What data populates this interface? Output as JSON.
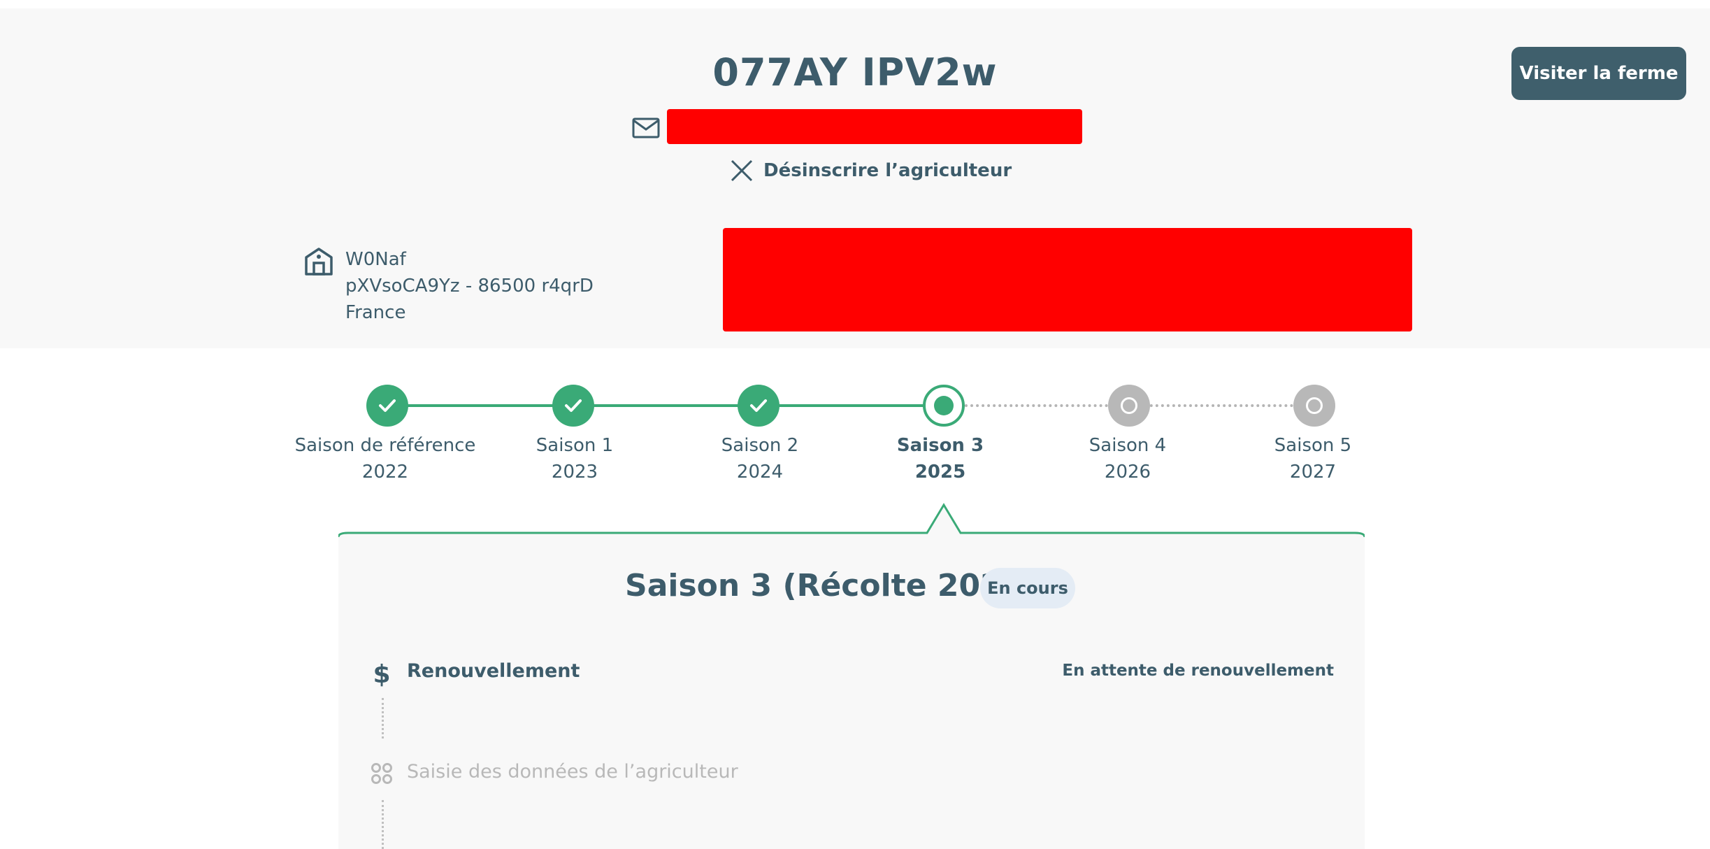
{
  "farmer": {
    "name": "077AY IPV2w",
    "unsubscribe_label": "Désinscrire l’agriculteur",
    "visit_farm_label": "Visiter la ferme"
  },
  "farm": {
    "name": "W0Naf",
    "address_line": "pXVsoCA9Yz - 86500 r4qrD",
    "country": "France"
  },
  "timeline": [
    {
      "label": "Saison de référence",
      "year": "2022",
      "state": "done"
    },
    {
      "label": "Saison 1",
      "year": "2023",
      "state": "done"
    },
    {
      "label": "Saison 2",
      "year": "2024",
      "state": "done"
    },
    {
      "label": "Saison 3",
      "year": "2025",
      "state": "current"
    },
    {
      "label": "Saison 4",
      "year": "2026",
      "state": "future"
    },
    {
      "label": "Saison 5",
      "year": "2027",
      "state": "future"
    }
  ],
  "season_panel": {
    "title": "Saison 3 (Récolte 2025)",
    "badge": "En cours",
    "steps": [
      {
        "label": "Renouvellement",
        "status": "En attente de renouvellement",
        "icon": "dollar-icon",
        "active": true
      },
      {
        "label": "Saisie des données de l’agriculteur",
        "status": "",
        "icon": "grid-icon",
        "active": false
      }
    ]
  },
  "colors": {
    "primary": "#3d5c6b",
    "accent_green": "#3aaa77",
    "inactive_grey": "#b8b8b8",
    "redaction": "#ff0000",
    "badge_bg": "#e4ecf5"
  }
}
